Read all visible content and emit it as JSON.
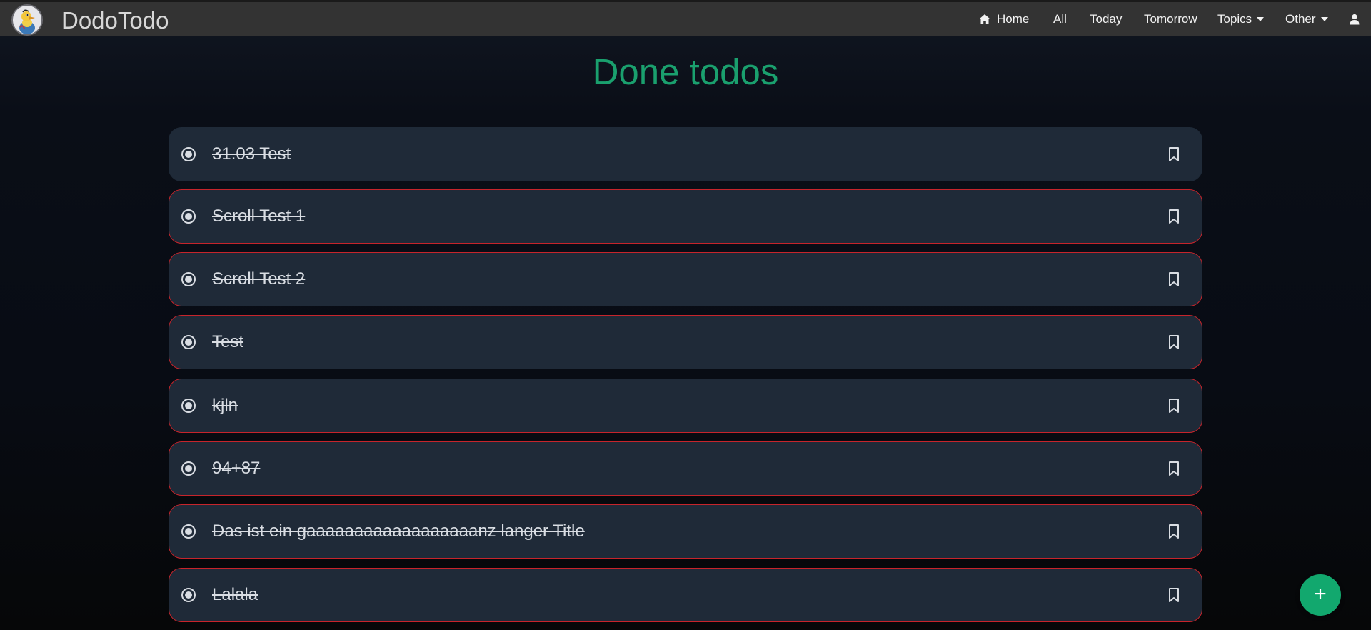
{
  "app": {
    "brand": "DodoTodo"
  },
  "nav": {
    "home": "Home",
    "all": "All",
    "today": "Today",
    "tomorrow": "Tomorrow",
    "topics": "Topics",
    "other": "Other"
  },
  "page": {
    "title": "Done todos"
  },
  "todos": [
    {
      "title": "31.03 Test",
      "highlighted": false
    },
    {
      "title": "Scroll Test 1",
      "highlighted": true
    },
    {
      "title": "Scroll Test 2",
      "highlighted": true
    },
    {
      "title": "Test",
      "highlighted": true
    },
    {
      "title": "kjln",
      "highlighted": true
    },
    {
      "title": "94+87",
      "highlighted": true
    },
    {
      "title": "Das ist ein gaaaaaaaaaaaaaaaaaanz langer Title",
      "highlighted": true
    },
    {
      "title": "Lalala",
      "highlighted": true
    }
  ],
  "fab": {
    "label": "+"
  },
  "colors": {
    "accent": "#1aa06e",
    "navbar": "#333333",
    "card": "#1f2a38",
    "card_border": "#c7242b",
    "fab": "#12a86e"
  },
  "icons": {
    "home": "home-icon",
    "user": "user-icon",
    "radio": "radio-checked-icon",
    "bookmark": "bookmark-icon",
    "add": "plus-icon"
  }
}
